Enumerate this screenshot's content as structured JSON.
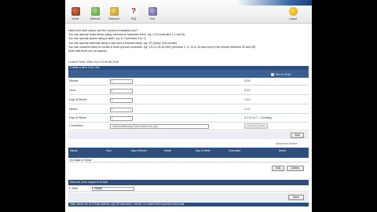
{
  "toolbar": {
    "items": [
      {
        "label": "Home",
        "icon": "home-icon"
      },
      {
        "label": "Webmail",
        "icon": "webmail-icon"
      },
      {
        "label": "Password",
        "icon": "password-icon"
      },
      {
        "label": "FAQ",
        "icon": "faq-icon"
      },
      {
        "label": "Help",
        "icon": "help-icon"
      }
    ],
    "logout_label": "Logout"
  },
  "intro": {
    "lines": [
      "Valid cron time values are the numbers indicated and *",
      "You can specify exact times using commas to separate them. eg: 1,2,5 (minutes 1,2 and 5)",
      "You can specify spans using a dash. eg: 5-7 (minutes 5 to 7)",
      "You can specify intervals using a star and a forward slash. eg: */2 (every 2nd minute)",
      "You can combine them to create a more precise schedule. eg: 1,5,11-15,30-59/2 (minutes 1, 5, 11 to 15 and every 2nd minute between 30 and 59)",
      "Note that there are no spaces."
    ]
  },
  "current_time": "Current Time: Wed Jul 4 15:40:38 2018",
  "form": {
    "title": "Create a New Cron Job",
    "run_as_label": "Run as Root",
    "rows": [
      {
        "label": "Minute",
        "value": "*",
        "range": "0-59"
      },
      {
        "label": "Hour",
        "value": "*",
        "range": "0-23"
      },
      {
        "label": "Day of Month",
        "value": "*",
        "range": "1-31"
      },
      {
        "label": "Month",
        "value": "*",
        "range": "1-12"
      },
      {
        "label": "Day of Week",
        "value": "*",
        "range": "0-7 (0 or 7 = Sunday)"
      }
    ],
    "command_label": "Command",
    "command_value": "/usr/local/bin/php /home/user/cron.php",
    "prevent_email_label": "Prevent Email",
    "add_label": "Add"
  },
  "advanced_label": "Advanced Search",
  "table": {
    "headers": [
      "Minute",
      "Hour",
      "Day of Month",
      "Month",
      "Day of Week",
      "Command",
      "Select"
    ],
    "empty_text": "No Data to Show",
    "edit_label": "Edit",
    "delete_label": "Delete"
  },
  "email": {
    "title": "Send all Cron output to E-Mail",
    "label": "E-Mail",
    "value": "mense",
    "save_label": "Save"
  },
  "footer_note": "Valid values are an E-Mail address, any DA username : mense, or a blank field to prevent any email.",
  "colors": {
    "header_bar": "#2e4f7d",
    "background": "#ffffff"
  }
}
